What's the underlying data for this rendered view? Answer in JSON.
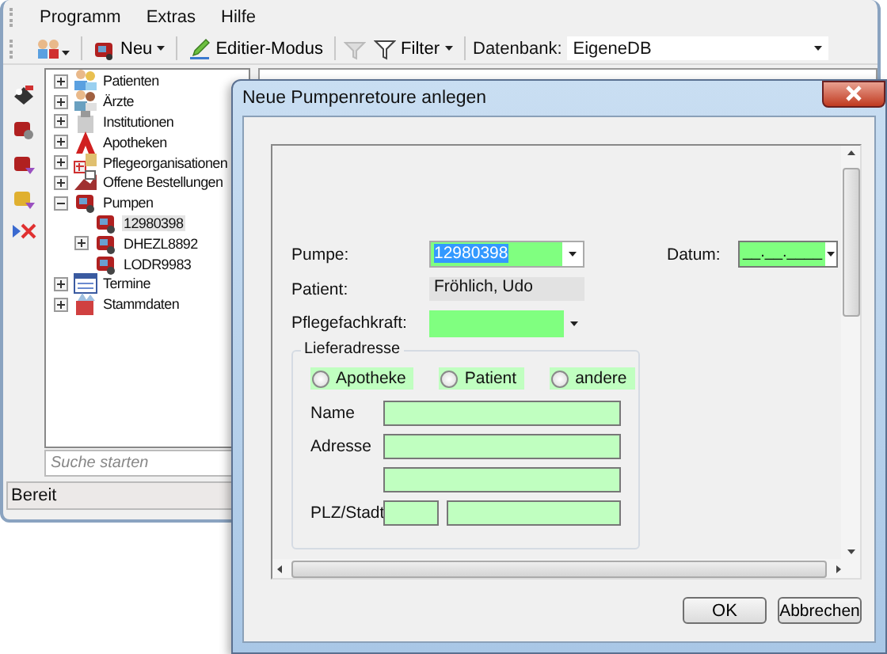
{
  "main_window": {
    "menu": [
      "Programm",
      "Extras",
      "Hilfe"
    ],
    "toolbar": {
      "new_label": "Neu",
      "edit_label": "Editier-Modus",
      "filter_label": "Filter",
      "db_label": "Datenbank:",
      "db_value": "EigeneDB"
    },
    "tree": [
      {
        "label": "Patienten",
        "kind": "group",
        "expanded": false,
        "selected": false
      },
      {
        "label": "Ärzte",
        "kind": "group",
        "expanded": false,
        "selected": false
      },
      {
        "label": "Institutionen",
        "kind": "group",
        "expanded": false,
        "selected": false
      },
      {
        "label": "Apotheken",
        "kind": "group",
        "expanded": false,
        "selected": false
      },
      {
        "label": "Pflegeorganisationen",
        "kind": "group",
        "expanded": false,
        "selected": false
      },
      {
        "label": "Offene Bestellungen",
        "kind": "group",
        "expanded": false,
        "selected": false
      },
      {
        "label": "Pumpen",
        "kind": "group",
        "expanded": true,
        "selected": false,
        "children": [
          {
            "label": "12980398",
            "kind": "leaf",
            "selected": true
          },
          {
            "label": "DHEZL8892",
            "kind": "group",
            "expanded": false,
            "selected": false
          },
          {
            "label": "LODR9983",
            "kind": "leaf",
            "selected": false
          }
        ]
      },
      {
        "label": "Termine",
        "kind": "group",
        "expanded": false,
        "selected": false
      },
      {
        "label": "Stammdaten",
        "kind": "group",
        "expanded": false,
        "selected": false
      }
    ],
    "search": {
      "placeholder": "Suche starten"
    },
    "status_bar": "Bereit"
  },
  "dialog": {
    "title": "Neue Pumpenretoure anlegen",
    "pumpe": {
      "label": "Pumpe:",
      "value": "12980398",
      "text_highlighted": true
    },
    "datum": {
      "label": "Datum:",
      "value": "__.__.____"
    },
    "patient": {
      "label": "Patient:",
      "value": "Fröhlich, Udo"
    },
    "pflegefachkraft": {
      "label": "Pflegefachkraft:"
    },
    "lieferadresse": {
      "title": "Lieferadresse",
      "options": [
        {
          "label": "Apotheke",
          "selected": false
        },
        {
          "label": "Patient",
          "selected": false
        },
        {
          "label": "andere",
          "selected": false
        }
      ],
      "name_label": "Name",
      "adresse_label": "Adresse",
      "plz_label": "PLZ/Stadt"
    },
    "buttons": [
      "OK",
      "Abbrechen"
    ]
  }
}
